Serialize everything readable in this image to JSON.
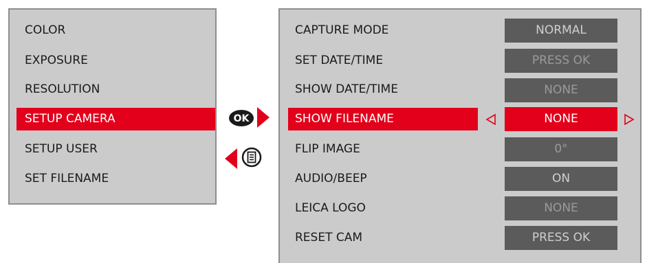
{
  "left_menu": {
    "items": [
      {
        "label": "COLOR"
      },
      {
        "label": "EXPOSURE"
      },
      {
        "label": "RESOLUTION"
      },
      {
        "label": "SETUP CAMERA"
      },
      {
        "label": "SETUP USER"
      },
      {
        "label": "SET FILENAME"
      }
    ],
    "active_index": 3
  },
  "nav": {
    "ok_label": "OK"
  },
  "settings": {
    "rows": [
      {
        "label": "CAPTURE MODE",
        "value": "NORMAL"
      },
      {
        "label": "SET DATE/TIME",
        "value": "PRESS OK"
      },
      {
        "label": "SHOW DATE/TIME",
        "value": "NONE"
      },
      {
        "label": "SHOW FILENAME",
        "value": "NONE"
      },
      {
        "label": "FLIP IMAGE",
        "value": "0°"
      },
      {
        "label": "AUDIO/BEEP",
        "value": "ON"
      },
      {
        "label": "LEICA LOGO",
        "value": "NONE"
      },
      {
        "label": "RESET CAM",
        "value": "PRESS OK"
      }
    ],
    "active_index": 3
  },
  "colors": {
    "accent": "#e2001a",
    "panel": "#cbcbcb",
    "value_box": "#5b5b5b"
  }
}
